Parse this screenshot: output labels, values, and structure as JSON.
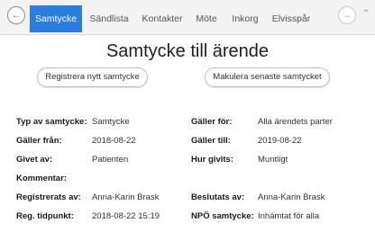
{
  "tabs": [
    {
      "label": "Samtycke",
      "active": true
    },
    {
      "label": "Sändlista",
      "active": false
    },
    {
      "label": "Kontakter",
      "active": false
    },
    {
      "label": "Möte",
      "active": false
    },
    {
      "label": "Inkorg",
      "active": false
    },
    {
      "label": "Elvisspår",
      "active": false
    }
  ],
  "nav": {
    "back_icon": "arrow-left-circle-icon",
    "forward_icon": "arrow-right-circle-icon",
    "collapse_icon": "chevron-up-icon"
  },
  "page": {
    "title": "Samtycke till ärende"
  },
  "actions": {
    "register": "Registrera nytt samtycke",
    "revoke": "Makulera senaste samtycket"
  },
  "details": {
    "typ_label": "Typ av samtycke:",
    "typ_value": "Samtycke",
    "galler_for_label": "Gäller för:",
    "galler_for_value": "Alla ärendets parter",
    "fran_label": "Gäller från:",
    "fran_value": "2018-08-22",
    "till_label": "Gäller till:",
    "till_value": "2019-08-22",
    "givet_label": "Givet av:",
    "givet_value": "Patienten",
    "hur_label": "Hur givits:",
    "hur_value": "Muntligt",
    "kommentar_label": "Kommentar:",
    "kommentar_value": "",
    "reg_av_label": "Registrerats av:",
    "reg_av_value": "Anna-Karin Brask",
    "beslut_label": "Beslutats av:",
    "beslut_value": "Anna-Karin Brask",
    "tidpunkt_label": "Reg. tidpunkt:",
    "tidpunkt_value": "2018-08-22 15:19",
    "npo_label": "NPÖ samtycke:",
    "npo_value": "Inhämtat för alla"
  },
  "colors": {
    "accent": "#2b7de0"
  }
}
